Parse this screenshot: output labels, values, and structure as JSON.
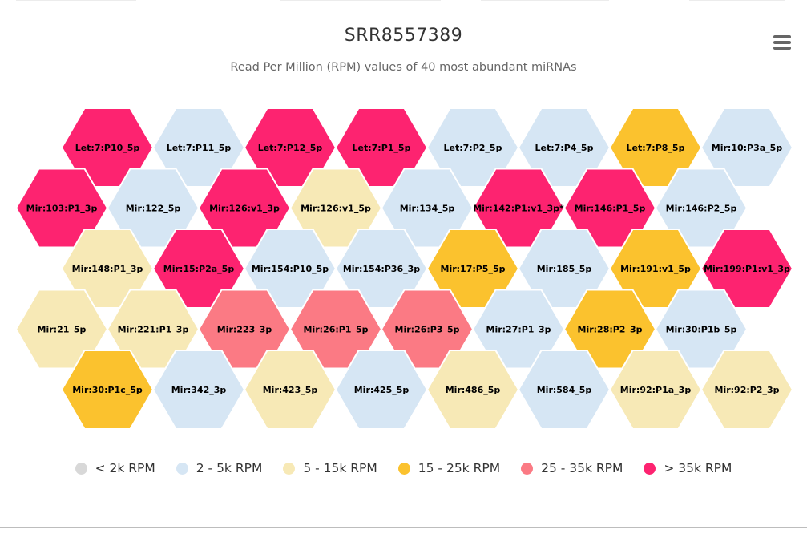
{
  "chart_data": {
    "type": "tilemap",
    "title": "SRR8557389",
    "subtitle": "Read Per Million (RPM) values of 40 most abundant miRNAs",
    "color_classes": [
      {
        "id": "lt2k",
        "label": "< 2k RPM",
        "color": "#d8d8d8"
      },
      {
        "id": "2to5k",
        "label": "2 - 5k RPM",
        "color": "#d6e6f4"
      },
      {
        "id": "5to15k",
        "label": "5 - 15k RPM",
        "color": "#f7e9b6"
      },
      {
        "id": "15to25k",
        "label": "15 - 25k RPM",
        "color": "#fbc22e"
      },
      {
        "id": "25to35k",
        "label": "25 - 35k RPM",
        "color": "#fb7a84"
      },
      {
        "id": "gt35k",
        "label": "> 35k RPM",
        "color": "#fd2370"
      }
    ],
    "rows": [
      [
        {
          "label": "Let:7:P10_5p",
          "class": "gt35k"
        },
        {
          "label": "Let:7:P11_5p",
          "class": "2to5k"
        },
        {
          "label": "Let:7:P12_5p",
          "class": "gt35k"
        },
        {
          "label": "Let:7:P1_5p",
          "class": "gt35k"
        },
        {
          "label": "Let:7:P2_5p",
          "class": "2to5k"
        },
        {
          "label": "Let:7:P4_5p",
          "class": "2to5k"
        },
        {
          "label": "Let:7:P8_5p",
          "class": "15to25k"
        },
        {
          "label": "Mir:10:P3a_5p",
          "class": "2to5k"
        }
      ],
      [
        {
          "label": "Mir:103:P1_3p",
          "class": "gt35k"
        },
        {
          "label": "Mir:122_5p",
          "class": "2to5k"
        },
        {
          "label": "Mir:126:v1_3p",
          "class": "gt35k"
        },
        {
          "label": "Mir:126:v1_5p",
          "class": "5to15k"
        },
        {
          "label": "Mir:134_5p",
          "class": "2to5k"
        },
        {
          "label": "Mir:142:P1:v1_3p*",
          "class": "gt35k"
        },
        {
          "label": "Mir:146:P1_5p",
          "class": "gt35k"
        },
        {
          "label": "Mir:146:P2_5p",
          "class": "2to5k"
        }
      ],
      [
        {
          "label": "Mir:148:P1_3p",
          "class": "5to15k"
        },
        {
          "label": "Mir:15:P2a_5p",
          "class": "gt35k"
        },
        {
          "label": "Mir:154:P10_5p",
          "class": "2to5k"
        },
        {
          "label": "Mir:154:P36_3p",
          "class": "2to5k"
        },
        {
          "label": "Mir:17:P5_5p",
          "class": "15to25k"
        },
        {
          "label": "Mir:185_5p",
          "class": "2to5k"
        },
        {
          "label": "Mir:191:v1_5p",
          "class": "15to25k"
        },
        {
          "label": "Mir:199:P1:v1_3p",
          "class": "gt35k"
        }
      ],
      [
        {
          "label": "Mir:21_5p",
          "class": "5to15k"
        },
        {
          "label": "Mir:221:P1_3p",
          "class": "5to15k"
        },
        {
          "label": "Mir:223_3p",
          "class": "25to35k"
        },
        {
          "label": "Mir:26:P1_5p",
          "class": "25to35k"
        },
        {
          "label": "Mir:26:P3_5p",
          "class": "25to35k"
        },
        {
          "label": "Mir:27:P1_3p",
          "class": "2to5k"
        },
        {
          "label": "Mir:28:P2_3p",
          "class": "15to25k"
        },
        {
          "label": "Mir:30:P1b_5p",
          "class": "2to5k"
        }
      ],
      [
        {
          "label": "Mir:30:P1c_5p",
          "class": "15to25k"
        },
        {
          "label": "Mir:342_3p",
          "class": "2to5k"
        },
        {
          "label": "Mir:423_5p",
          "class": "5to15k"
        },
        {
          "label": "Mir:425_5p",
          "class": "2to5k"
        },
        {
          "label": "Mir:486_5p",
          "class": "5to15k"
        },
        {
          "label": "Mir:584_5p",
          "class": "2to5k"
        },
        {
          "label": "Mir:92:P1a_3p",
          "class": "5to15k"
        },
        {
          "label": "Mir:92:P2_3p",
          "class": "5to15k"
        }
      ]
    ]
  },
  "menu": {
    "icon": "hamburger-menu-icon"
  }
}
